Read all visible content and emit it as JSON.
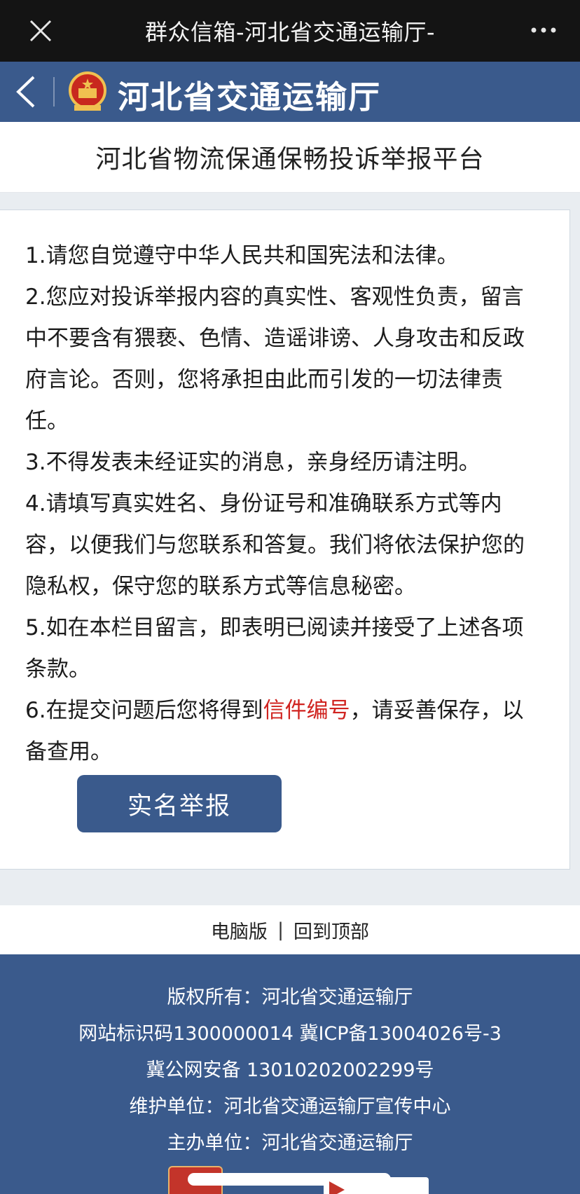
{
  "topbar": {
    "title": "群众信箱-河北省交通运输厅-",
    "close_icon": "close-icon",
    "more_icon": "more-icon"
  },
  "brandbar": {
    "name": "河北省交通运输厅",
    "back_icon": "chevron-left-icon",
    "emblem_icon": "national-emblem-icon"
  },
  "platform": {
    "title": "河北省物流保通保畅投诉举报平台"
  },
  "notice": {
    "items": [
      "1.请您自觉遵守中华人民共和国宪法和法律。",
      "2.您应对投诉举报内容的真实性、客观性负责，留言中不要含有猥亵、色情、造谣诽谤、人身攻击和反政府言论。否则，您将承担由此而引发的一切法律责任。",
      "3.不得发表未经证实的消息，亲身经历请注明。",
      "4.请填写真实姓名、身份证号和准确联系方式等内容，以便我们与您联系和答复。我们将依法保护您的隐私权，保守您的联系方式等信息秘密。",
      "5.如在本栏目留言，即表明已阅读并接受了上述各项条款。"
    ],
    "item6": {
      "before": "6.在提交问题后您将得到",
      "highlight": "信件编号",
      "after": "，请妥善保存，以备查用。"
    },
    "highlight_color": "#d0231f"
  },
  "report_button": {
    "label": "实名举报"
  },
  "links": {
    "desktop": "电脑版",
    "separator": "|",
    "back_to_top": "回到顶部"
  },
  "footer": {
    "lines": [
      "版权所有：河北省交通运输厅",
      "网站标识码1300000014 冀ICP备13004026号-3",
      "冀公网安备 13010202002299号",
      "维护单位：河北省交通运输厅宣传中心",
      "主办单位：河北省交通运输厅"
    ]
  },
  "colors": {
    "brand_blue": "#3a5a8c",
    "topbar_black": "#141414",
    "content_bg": "#e9edf1"
  }
}
